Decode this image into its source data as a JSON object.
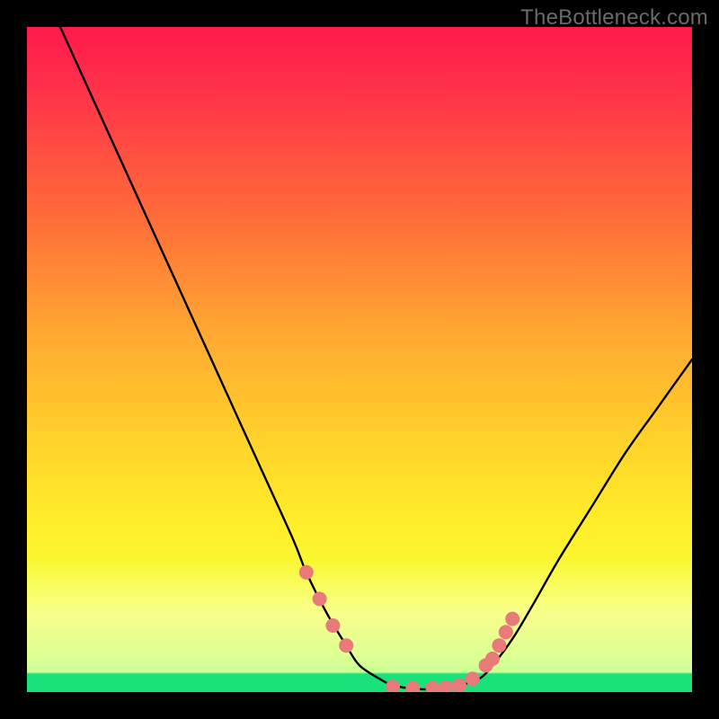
{
  "watermark": "TheBottleneck.com",
  "chart_data": {
    "type": "line",
    "title": "",
    "xlabel": "",
    "ylabel": "",
    "xlim": [
      0,
      100
    ],
    "ylim": [
      0,
      100
    ],
    "series": [
      {
        "name": "curve",
        "x": [
          5,
          10,
          15,
          20,
          25,
          30,
          35,
          40,
          42,
          45,
          48,
          50,
          53,
          55,
          58,
          60,
          63,
          65,
          68,
          70,
          73,
          76,
          80,
          85,
          90,
          95,
          100
        ],
        "y": [
          100,
          89,
          78,
          67,
          56,
          45,
          34,
          23,
          18,
          12,
          7,
          4,
          2,
          1,
          0.5,
          0.4,
          0.5,
          1,
          2,
          4,
          8,
          13,
          20,
          28,
          36,
          43,
          50
        ]
      }
    ],
    "markers": {
      "name": "highlight-dots",
      "color": "#e87a7a",
      "x": [
        42,
        44,
        46,
        48,
        55,
        58,
        61,
        63,
        65,
        67,
        69,
        70,
        71,
        72,
        73
      ],
      "y": [
        18,
        14,
        10,
        7,
        0.8,
        0.6,
        0.6,
        0.7,
        1,
        2,
        4,
        5,
        7,
        9,
        11
      ]
    },
    "gradient_stops": [
      {
        "pos": 0,
        "color": "#ff1a4a"
      },
      {
        "pos": 28,
        "color": "#ff6a3a"
      },
      {
        "pos": 62,
        "color": "#ffd22a"
      },
      {
        "pos": 86,
        "color": "#f4ff3a"
      },
      {
        "pos": 97,
        "color": "#8cff7a"
      },
      {
        "pos": 100,
        "color": "#19e27a"
      }
    ]
  }
}
